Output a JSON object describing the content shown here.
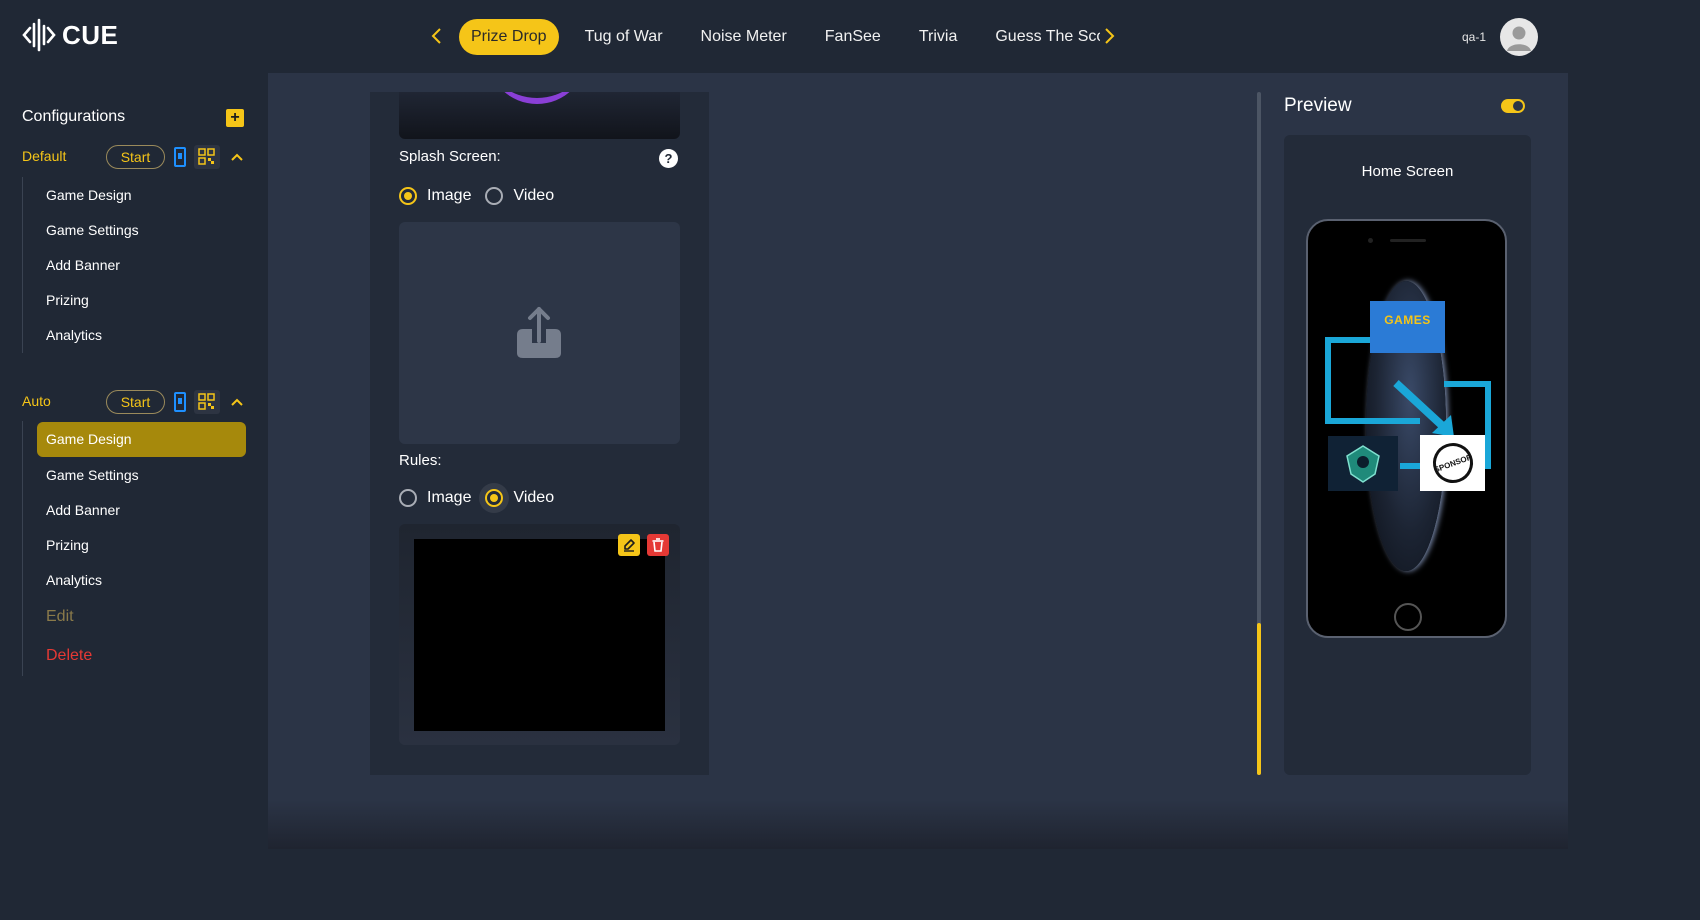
{
  "app": {
    "logo_text": "CUE"
  },
  "top_nav": {
    "tabs": [
      "Prize Drop",
      "Tug of War",
      "Noise Meter",
      "FanSee",
      "Trivia",
      "Guess The Sco"
    ],
    "active_tab": "Prize Drop",
    "user": "qa-1"
  },
  "sidebar": {
    "title": "Configurations",
    "groups": [
      {
        "name": "Default",
        "start_label": "Start",
        "items": [
          "Game Design",
          "Game Settings",
          "Add Banner",
          "Prizing",
          "Analytics"
        ]
      },
      {
        "name": "Auto",
        "start_label": "Start",
        "items": [
          "Game Design",
          "Game Settings",
          "Add Banner",
          "Prizing",
          "Analytics"
        ],
        "active_item": "Game Design",
        "edit_label": "Edit",
        "delete_label": "Delete"
      }
    ]
  },
  "form": {
    "splash_label": "Splash Screen:",
    "splash_options": [
      "Image",
      "Video"
    ],
    "splash_selected": "Image",
    "rules_label": "Rules:",
    "rules_options": [
      "Image",
      "Video"
    ],
    "rules_selected": "Video",
    "help_glyph": "?"
  },
  "preview": {
    "title": "Preview",
    "subtitle": "Home Screen",
    "toggle_on": true,
    "tiles": {
      "games": "GAMES",
      "sponsor": "SPONSOR"
    }
  },
  "colors": {
    "accent": "#f5c518",
    "danger": "#e53935",
    "phone_icon": "#1e90ff",
    "background": "#202835",
    "panel": "#2b3446"
  }
}
